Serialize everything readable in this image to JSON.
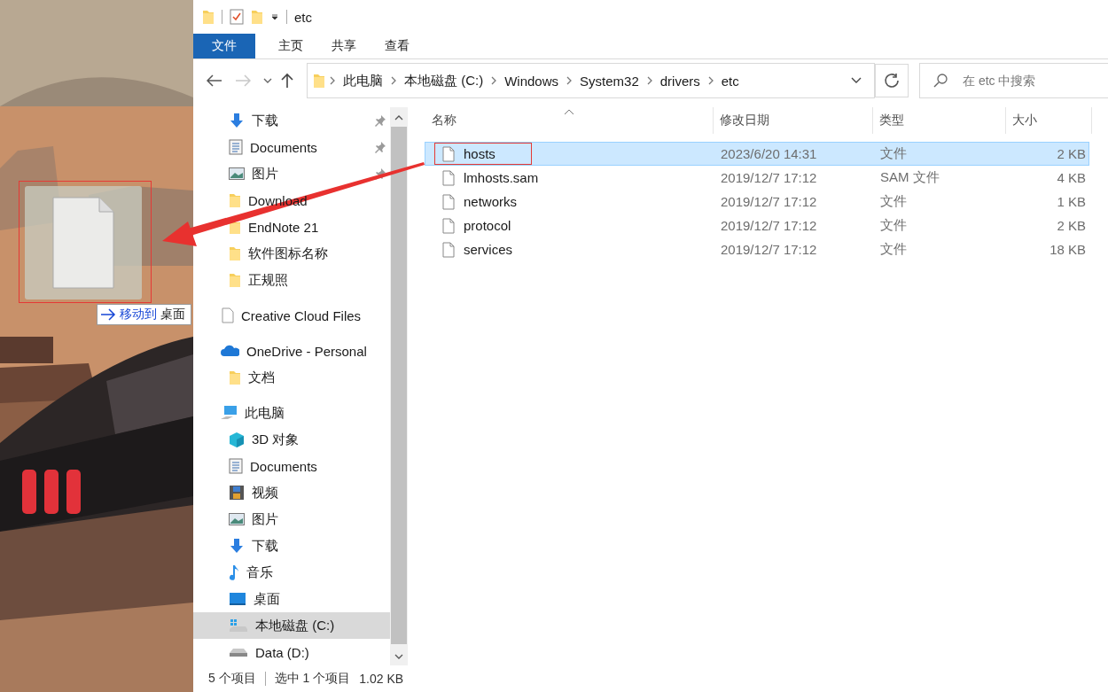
{
  "window": {
    "title": "etc"
  },
  "ribbon_tabs": [
    {
      "label": "文件",
      "kind": "file-menu"
    },
    {
      "label": "主页",
      "kind": "tab"
    },
    {
      "label": "共享",
      "kind": "tab"
    },
    {
      "label": "查看",
      "kind": "tab"
    }
  ],
  "navigation": {
    "back_disabled": false,
    "forward_disabled": true
  },
  "address_bar": {
    "segments": [
      "此电脑",
      "本地磁盘 (C:)",
      "Windows",
      "System32",
      "drivers",
      "etc"
    ]
  },
  "search": {
    "placeholder": "在 etc 中搜索"
  },
  "quick_access": {
    "items": [
      {
        "label": "下载",
        "kind": "download",
        "pinned": true,
        "selected": false
      },
      {
        "label": "Documents",
        "kind": "document",
        "pinned": true,
        "selected": false
      },
      {
        "label": "图片",
        "kind": "picture",
        "pinned": true,
        "selected": false
      },
      {
        "label": "Download",
        "kind": "folder",
        "pinned": false,
        "selected": false
      },
      {
        "label": "EndNote 21",
        "kind": "folder",
        "pinned": false,
        "selected": false
      },
      {
        "label": "软件图标名称",
        "kind": "folder",
        "pinned": false,
        "selected": false
      },
      {
        "label": "正规照",
        "kind": "folder",
        "pinned": false,
        "selected": false
      }
    ]
  },
  "tree": [
    {
      "label": "Creative Cloud Files",
      "kind": "blank",
      "selected": false
    },
    {
      "label": "OneDrive - Personal",
      "kind": "cloud",
      "selected": false,
      "children": [
        {
          "label": "文档",
          "kind": "folder",
          "selected": false
        }
      ]
    },
    {
      "label": "此电脑",
      "kind": "pc",
      "selected": false,
      "children": [
        {
          "label": "3D 对象",
          "kind": "cube",
          "selected": false
        },
        {
          "label": "Documents",
          "kind": "document",
          "selected": false
        },
        {
          "label": "视频",
          "kind": "video",
          "selected": false
        },
        {
          "label": "图片",
          "kind": "picture",
          "selected": false
        },
        {
          "label": "下载",
          "kind": "download",
          "selected": false
        },
        {
          "label": "音乐",
          "kind": "music",
          "selected": false
        },
        {
          "label": "桌面",
          "kind": "desktop",
          "selected": false
        },
        {
          "label": "本地磁盘 (C:)",
          "kind": "system-drive",
          "selected": true
        },
        {
          "label": "Data (D:)",
          "kind": "drive",
          "selected": false
        }
      ]
    }
  ],
  "table": {
    "columns": [
      {
        "label": "名称",
        "sorted": true
      },
      {
        "label": "修改日期",
        "sorted": false
      },
      {
        "label": "类型",
        "sorted": false
      },
      {
        "label": "大小",
        "sorted": false
      }
    ],
    "rows": [
      {
        "name": "hosts",
        "modified": "2023/6/20 14:31",
        "type": "文件",
        "size": "2 KB",
        "selected": true,
        "annotated": true
      },
      {
        "name": "lmhosts.sam",
        "modified": "2019/12/7 17:12",
        "type": "SAM 文件",
        "size": "4 KB",
        "selected": false,
        "annotated": false
      },
      {
        "name": "networks",
        "modified": "2019/12/7 17:12",
        "type": "文件",
        "size": "1 KB",
        "selected": false,
        "annotated": false
      },
      {
        "name": "protocol",
        "modified": "2019/12/7 17:12",
        "type": "文件",
        "size": "2 KB",
        "selected": false,
        "annotated": false
      },
      {
        "name": "services",
        "modified": "2019/12/7 17:12",
        "type": "文件",
        "size": "18 KB",
        "selected": false,
        "annotated": false
      }
    ]
  },
  "status_bar": {
    "item_count": "5 个项目",
    "selection": "选中 1 个项目",
    "selection_size": "1.02 KB"
  },
  "desktop": {
    "drag_tooltip": {
      "action": "移动到",
      "target": "桌面"
    }
  }
}
